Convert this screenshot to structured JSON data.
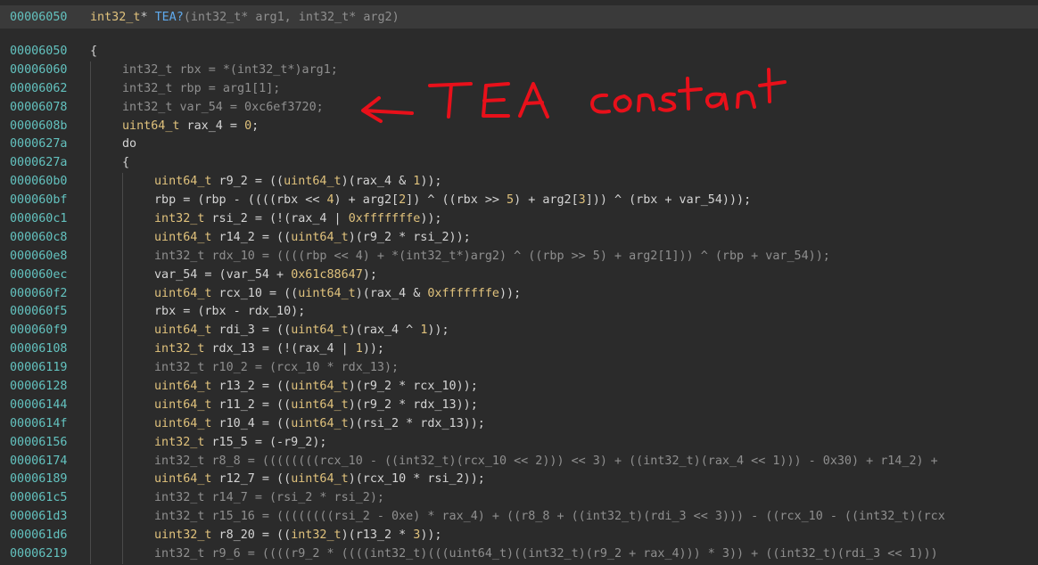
{
  "header": {
    "address": "00006050",
    "return_type": "int32_t",
    "star": "* ",
    "function_name": "TEA?",
    "params": "(int32_t* arg1, int32_t* arg2)"
  },
  "annotation": {
    "text": "TEA constant"
  },
  "lines": [
    {
      "addr": "00006050",
      "indent": 0,
      "text": "{",
      "dim": false
    },
    {
      "addr": "00006060",
      "indent": 1,
      "text": "int32_t rbx = *(int32_t*)arg1;",
      "dim": true
    },
    {
      "addr": "00006062",
      "indent": 1,
      "text": "int32_t rbp = arg1[1];",
      "dim": true
    },
    {
      "addr": "00006078",
      "indent": 1,
      "text": "int32_t var_54 = 0xc6ef3720;",
      "dim": true
    },
    {
      "addr": "0000608b",
      "indent": 1,
      "text": "uint64_t rax_4 = 0;",
      "dim": false
    },
    {
      "addr": "0000627a",
      "indent": 1,
      "text": "do",
      "dim": false
    },
    {
      "addr": "0000627a",
      "indent": 1,
      "text": "{",
      "dim": false
    },
    {
      "addr": "000060b0",
      "indent": 2,
      "text": "uint64_t r9_2 = ((uint64_t)(rax_4 & 1));",
      "dim": false
    },
    {
      "addr": "000060bf",
      "indent": 2,
      "text": "rbp = (rbp - ((((rbx << 4) + arg2[2]) ^ ((rbx >> 5) + arg2[3])) ^ (rbx + var_54)));",
      "dim": false
    },
    {
      "addr": "000060c1",
      "indent": 2,
      "text": "int32_t rsi_2 = (!(rax_4 | 0xfffffffe));",
      "dim": false
    },
    {
      "addr": "000060c8",
      "indent": 2,
      "text": "uint64_t r14_2 = ((uint64_t)(r9_2 * rsi_2));",
      "dim": false
    },
    {
      "addr": "000060e8",
      "indent": 2,
      "text": "int32_t rdx_10 = ((((rbp << 4) + *(int32_t*)arg2) ^ ((rbp >> 5) + arg2[1])) ^ (rbp + var_54));",
      "dim": true
    },
    {
      "addr": "000060ec",
      "indent": 2,
      "text": "var_54 = (var_54 + 0x61c88647);",
      "dim": false
    },
    {
      "addr": "000060f2",
      "indent": 2,
      "text": "uint64_t rcx_10 = ((uint64_t)(rax_4 & 0xfffffffe));",
      "dim": false
    },
    {
      "addr": "000060f5",
      "indent": 2,
      "text": "rbx = (rbx - rdx_10);",
      "dim": false
    },
    {
      "addr": "000060f9",
      "indent": 2,
      "text": "uint64_t rdi_3 = ((uint64_t)(rax_4 ^ 1));",
      "dim": false
    },
    {
      "addr": "00006108",
      "indent": 2,
      "text": "int32_t rdx_13 = (!(rax_4 | 1));",
      "dim": false
    },
    {
      "addr": "00006119",
      "indent": 2,
      "text": "int32_t r10_2 = (rcx_10 * rdx_13);",
      "dim": true
    },
    {
      "addr": "00006128",
      "indent": 2,
      "text": "uint64_t r13_2 = ((uint64_t)(r9_2 * rcx_10));",
      "dim": false
    },
    {
      "addr": "00006144",
      "indent": 2,
      "text": "uint64_t r11_2 = ((uint64_t)(r9_2 * rdx_13));",
      "dim": false
    },
    {
      "addr": "0000614f",
      "indent": 2,
      "text": "uint64_t r10_4 = ((uint64_t)(rsi_2 * rdx_13));",
      "dim": false
    },
    {
      "addr": "00006156",
      "indent": 2,
      "text": "int32_t r15_5 = (-r9_2);",
      "dim": false
    },
    {
      "addr": "00006174",
      "indent": 2,
      "text": "int32_t r8_8 = ((((((((rcx_10 - ((int32_t)(rcx_10 << 2))) << 3) + ((int32_t)(rax_4 << 1))) - 0x30) + r14_2) +",
      "dim": true
    },
    {
      "addr": "00006189",
      "indent": 2,
      "text": "uint64_t r12_7 = ((uint64_t)(rcx_10 * rsi_2));",
      "dim": false
    },
    {
      "addr": "000061c5",
      "indent": 2,
      "text": "int32_t r14_7 = (rsi_2 * rsi_2);",
      "dim": true
    },
    {
      "addr": "000061d3",
      "indent": 2,
      "text": "int32_t r15_16 = ((((((((rsi_2 - 0xe) * rax_4) + ((r8_8 + ((int32_t)(rdi_3 << 3))) - ((rcx_10 - ((int32_t)(rcx",
      "dim": true
    },
    {
      "addr": "000061d6",
      "indent": 2,
      "text": "uint32_t r8_20 = ((int32_t)(r13_2 * 3));",
      "dim": false
    },
    {
      "addr": "00006219",
      "indent": 2,
      "text": "int32_t r9_6 = ((((r9_2 * ((((int32_t)(((uint64_t)((int32_t)(r9_2 + rax_4))) * 3)) + ((int32_t)(rdi_3 << 1)))",
      "dim": true
    }
  ]
}
